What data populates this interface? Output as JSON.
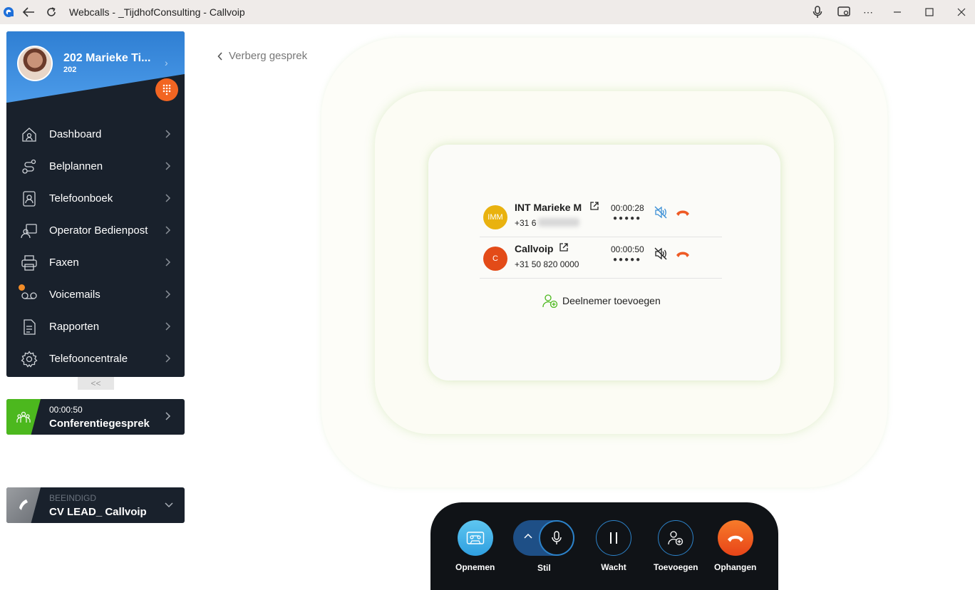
{
  "window": {
    "title": "Webcalls - _TijdhofConsulting - Callvoip"
  },
  "profile": {
    "name": "202 Marieke Ti...",
    "extension": "202"
  },
  "nav": {
    "items": [
      {
        "label": "Dashboard",
        "icon": "home-icon"
      },
      {
        "label": "Belplannen",
        "icon": "route-icon"
      },
      {
        "label": "Telefoonboek",
        "icon": "contact-book-icon"
      },
      {
        "label": "Operator Bedienpost",
        "icon": "operator-icon"
      },
      {
        "label": "Faxen",
        "icon": "printer-icon"
      },
      {
        "label": "Voicemails",
        "icon": "voicemail-icon"
      },
      {
        "label": "Rapporten",
        "icon": "report-icon"
      },
      {
        "label": "Telefooncentrale",
        "icon": "gear-icon"
      }
    ],
    "collapse_label": "<<"
  },
  "active_call": {
    "timer": "00:00:50",
    "title": "Conferentiegesprek",
    "accent": "#4cb81e"
  },
  "ended_call": {
    "status": "BEEINDIGD",
    "title": "CV LEAD_ Callvoip",
    "accent": "#7b7f85"
  },
  "back_link": "Verberg gesprek",
  "participants": [
    {
      "initials": "IMM",
      "name": "INT Marieke M",
      "number": "+31 6",
      "duration": "00:00:28",
      "dots": "●●●●●",
      "avatar_color": "#e9b20f"
    },
    {
      "initials": "C",
      "name": "Callvoip",
      "number": "+31 50 820 0000",
      "duration": "00:00:50",
      "dots": "●●●●●",
      "avatar_color": "#e34b18"
    }
  ],
  "add_participant_label": "Deelnemer toevoegen",
  "controls": {
    "record": "Opnemen",
    "mute": "Stil",
    "hold": "Wacht",
    "add": "Toevoegen",
    "hangup": "Ophangen"
  }
}
